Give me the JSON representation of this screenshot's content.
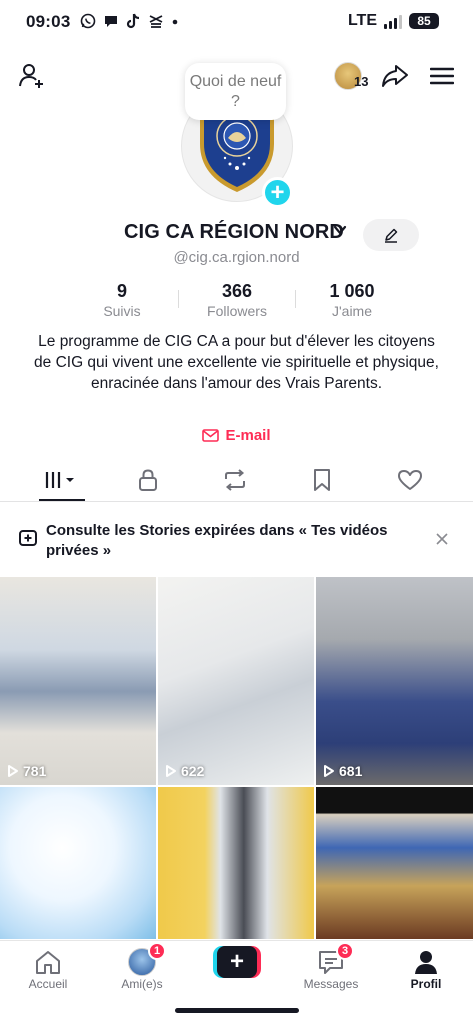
{
  "status_bar": {
    "time": "09:03",
    "network": "LTE",
    "battery": "85",
    "app_icons": [
      "whatsapp-icon",
      "chat-bubble-icon",
      "tiktok-icon",
      "capcut-icon",
      "dot-icon"
    ]
  },
  "top_nav": {
    "notification_count": "13"
  },
  "avatar": {
    "status_bubble": "Quoi de neuf ?"
  },
  "profile": {
    "name": "CIG CA RÉGION NORD",
    "username": "@cig.ca.rgion.nord",
    "stats": {
      "following_value": "9",
      "following_label": "Suivis",
      "followers_value": "366",
      "followers_label": "Followers",
      "likes_value": "1 060",
      "likes_label": "J'aime"
    },
    "bio": "Le programme de CIG CA a pour but d'élever les citoyens de CIG qui vivent une excellente vie spirituelle et physique, enracinée dans l'amour des Vrais Parents.",
    "email_label": "E-mail"
  },
  "banner": {
    "text": "Consulte les Stories expirées dans « Tes vidéos privées »"
  },
  "videos": [
    {
      "views": "781"
    },
    {
      "views": "622"
    },
    {
      "views": "681"
    },
    {
      "views": ""
    },
    {
      "views": ""
    },
    {
      "views": ""
    }
  ],
  "bottom_nav": {
    "home_label": "Accueil",
    "friends_label": "Ami(e)s",
    "friends_badge": "1",
    "messages_label": "Messages",
    "messages_badge": "3",
    "profile_label": "Profil"
  },
  "colors": {
    "accent_red": "#fe2c55",
    "accent_cyan": "#20d5ec",
    "text_primary": "#161823",
    "text_secondary": "#8a8b91"
  }
}
